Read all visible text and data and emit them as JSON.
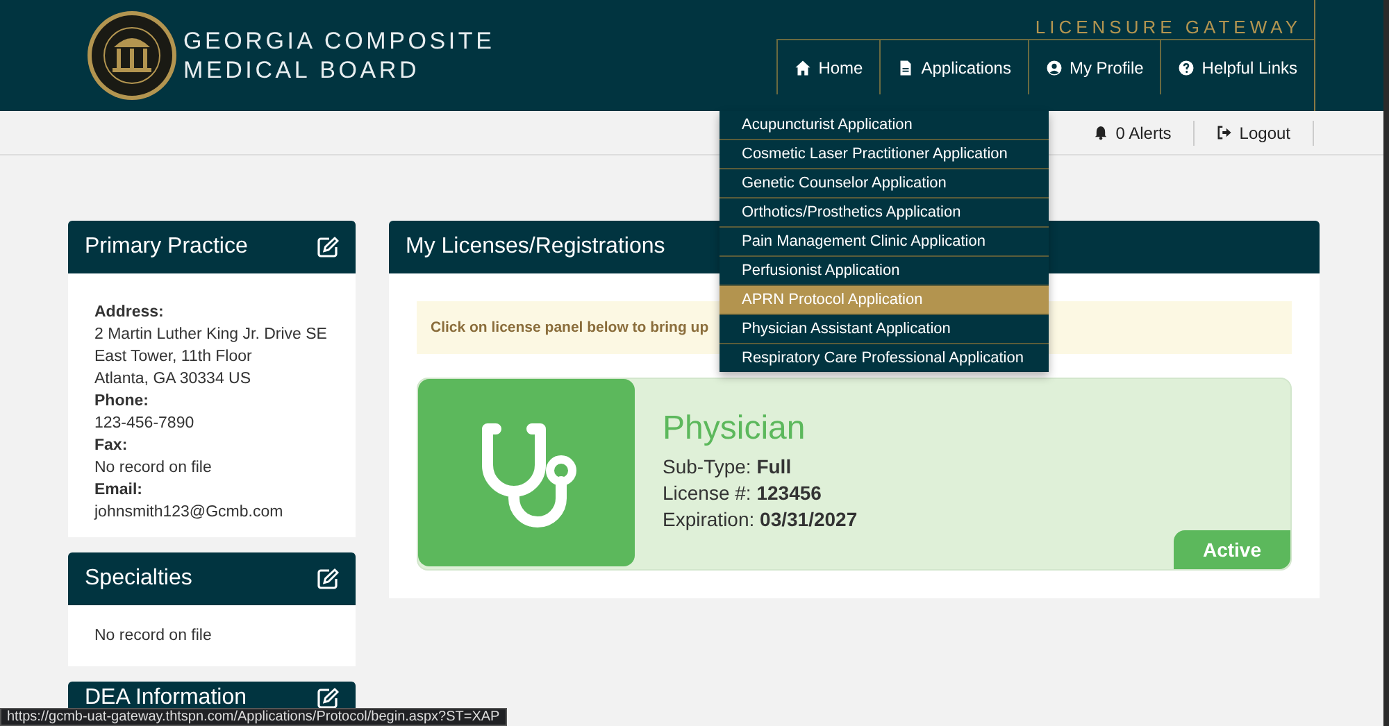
{
  "header": {
    "title_lines": [
      "GEORGIA COMPOSITE",
      "MEDICAL BOARD"
    ],
    "subtitle": "LICENSURE GATEWAY"
  },
  "nav": [
    {
      "label": "Home"
    },
    {
      "label": "Applications"
    },
    {
      "label": "My Profile"
    },
    {
      "label": "Helpful Links"
    }
  ],
  "utility_links": [
    {
      "label": "0 Alerts"
    },
    {
      "label": "Logout"
    }
  ],
  "applications_menu": [
    {
      "label": "Acupuncturist Application",
      "selected": false
    },
    {
      "label": "Cosmetic Laser Practitioner Application",
      "selected": false
    },
    {
      "label": "Genetic Counselor Application",
      "selected": false
    },
    {
      "label": "Orthotics/Prosthetics Application",
      "selected": false
    },
    {
      "label": "Pain Management Clinic Application",
      "selected": false
    },
    {
      "label": "Perfusionist Application",
      "selected": false
    },
    {
      "label": "APRN Protocol Application",
      "selected": true
    },
    {
      "label": "Physician Assistant Application",
      "selected": false
    },
    {
      "label": "Respiratory Care Professional Application",
      "selected": false
    }
  ],
  "sidebar": [
    {
      "title": "Primary Practice",
      "kind": "contact",
      "fields": [
        {
          "label": "Address:",
          "lines": [
            "2 Martin Luther King Jr. Drive SE",
            "East Tower, 11th Floor",
            "Atlanta, GA 30334 US"
          ]
        },
        {
          "label": "Phone:",
          "lines": [
            "123-456-7890"
          ]
        },
        {
          "label": "Fax:",
          "lines": [
            "No record on file"
          ]
        },
        {
          "label": "Email:",
          "lines": [
            "johnsmith123@Gcmb.com"
          ]
        }
      ]
    },
    {
      "title": "Specialties",
      "kind": "text",
      "text": "No record on file"
    },
    {
      "title": "DEA Information",
      "kind": "header_only"
    }
  ],
  "licenses": {
    "title": "My Licenses/Registrations",
    "notice": "Click on license panel below to bring up",
    "cards": [
      {
        "name": "Physician",
        "fields": [
          {
            "label": "Sub-Type:",
            "value": "Full"
          },
          {
            "label": "License #:",
            "value": "123456"
          },
          {
            "label": "Expiration:",
            "value": "03/31/2027"
          }
        ],
        "status": "Active"
      }
    ]
  },
  "status_url": "https://gcmb-uat-gateway.thtspn.com/Applications/Protocol/begin.aspx?ST=XAP"
}
